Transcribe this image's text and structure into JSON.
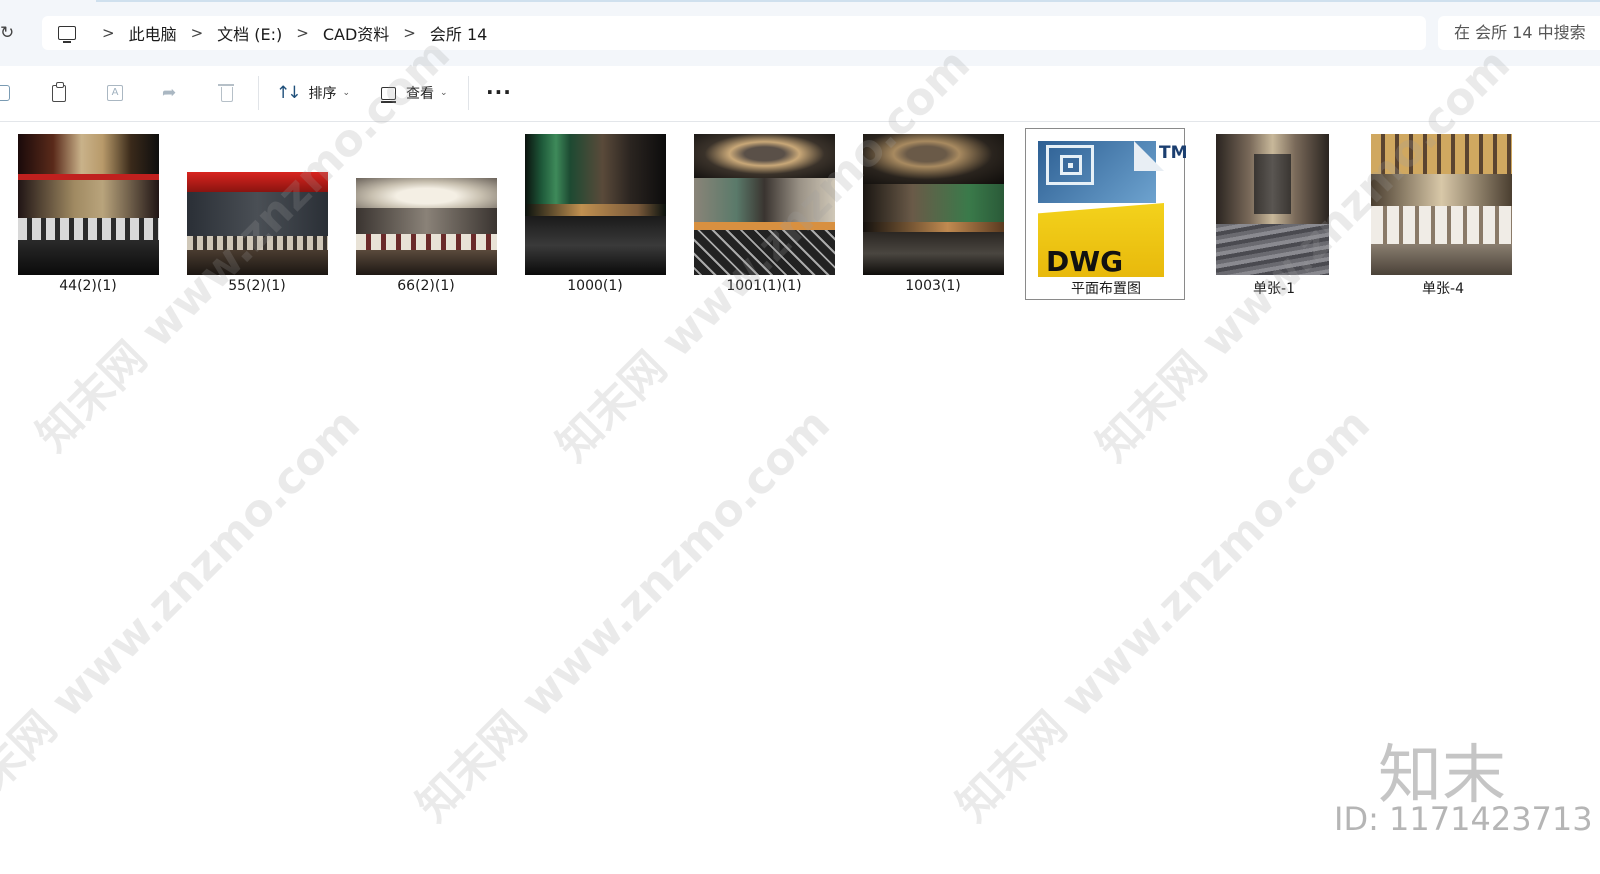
{
  "address_bar": {
    "refresh_icon": "refresh-icon",
    "computer_icon": "computer-icon",
    "crumbs": [
      "此电脑",
      "文档 (E:)",
      "CAD资料",
      "会所 14"
    ],
    "separator": ">"
  },
  "search": {
    "placeholder": "在 会所 14 中搜索"
  },
  "toolbar": {
    "icons": [
      "copy-icon",
      "paste-icon",
      "rename-icon",
      "share-icon",
      "delete-icon"
    ],
    "sort_label": "排序",
    "view_label": "查看",
    "more_label": "···"
  },
  "files": [
    {
      "name": "44(2)(1)",
      "type": "image"
    },
    {
      "name": "55(2)(1)",
      "type": "image"
    },
    {
      "name": "66(2)(1)",
      "type": "image"
    },
    {
      "name": "1000(1)",
      "type": "image"
    },
    {
      "name": "1001(1)(1)",
      "type": "image"
    },
    {
      "name": "1003(1)",
      "type": "image"
    },
    {
      "name": "平面布置图",
      "type": "dwg",
      "selected": true
    },
    {
      "name": "单张-1",
      "type": "image"
    },
    {
      "name": "单张-4",
      "type": "image"
    }
  ],
  "dwg_icon": {
    "text": "DWG",
    "tm": "TM"
  },
  "watermark": {
    "text": "知末网 www.znzmo.com",
    "brand": "知末",
    "id": "ID: 1171423713"
  }
}
